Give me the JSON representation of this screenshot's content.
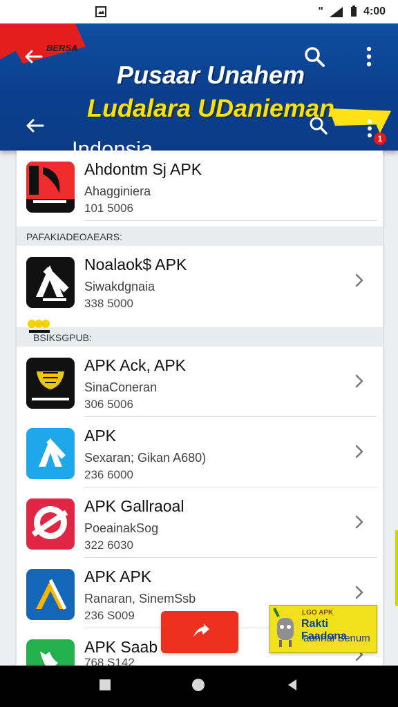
{
  "status_bar": {
    "signal_text": "ʺ",
    "time": "4:00"
  },
  "app_bar": {
    "ribbon_label": "BERSA",
    "headline_line1": "Pusaar Unahem",
    "headline_line2": "Ludalara UDanieman",
    "search_title": "Indonsia",
    "notification_count": "1"
  },
  "sections": [
    {
      "header": "",
      "items": [
        {
          "title": "Ahdontm Sj APK",
          "subtitle": "Ahagginiera",
          "meta": "101 5006"
        }
      ]
    },
    {
      "header": "PAFAKIADEOAEARS:",
      "items": [
        {
          "title": "Noalaok$ APK",
          "subtitle": "Siwakdgnaia",
          "meta": "338 5000"
        }
      ]
    },
    {
      "header": "BSIKSGPUB:",
      "items": [
        {
          "title": "APK Ack, APK",
          "subtitle": "SinaConeran",
          "meta": "306 5006"
        },
        {
          "title": "APK",
          "subtitle": "Sexaran; Gikan A680)",
          "meta": "236 6000"
        },
        {
          "title": "APK Gallraoal",
          "subtitle": "PoeainakSog",
          "meta": "322 6030"
        },
        {
          "title": "APK APK",
          "subtitle": "Ranaran, SinemSsb",
          "meta": "236 S009"
        },
        {
          "title": "APK Saab",
          "subtitle": "",
          "meta": "768 S142"
        }
      ]
    }
  ],
  "promo_banner": {
    "mini": "LGO APK",
    "title": "Rakti Faadona",
    "subtitle": "auhnai Senum"
  },
  "colors": {
    "header_blue": "#0b3f8d",
    "headline_yellow": "#f4e211",
    "accent_red": "#e41d1d"
  },
  "icons": {
    "back": "arrow-left-icon",
    "search": "search-icon",
    "menu": "more-vert-icon",
    "chevron": "chevron-right-icon"
  }
}
